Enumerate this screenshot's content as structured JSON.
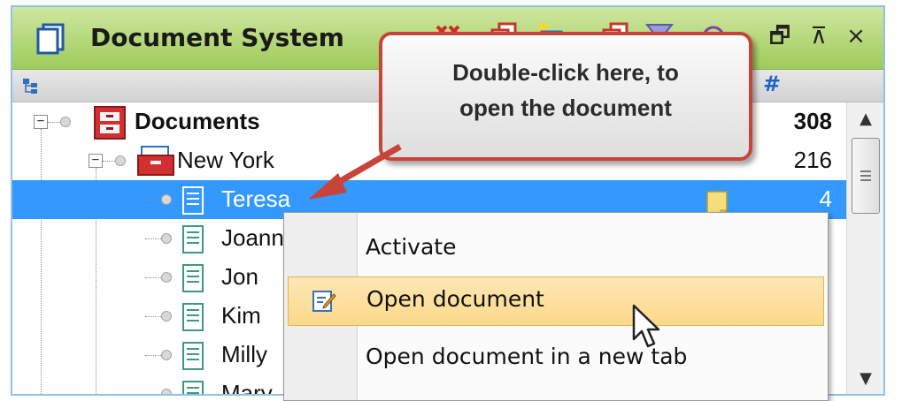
{
  "window": {
    "title": "Document System",
    "toolbar_icons": [
      "delete-icon",
      "copy-icon",
      "new-document-icon",
      "export-icon",
      "filter-icon",
      "search-icon"
    ],
    "window_buttons": {
      "restore": "🗗",
      "pin": "⊼",
      "close": "×"
    }
  },
  "column_header": {
    "tree_icon": "tree-structure-icon",
    "count_symbol": "#"
  },
  "tree": {
    "root": {
      "label": "Documents",
      "count": "308"
    },
    "group": {
      "label": "New York",
      "count": "216"
    },
    "items": [
      {
        "label": "Teresa",
        "count": "4",
        "selected": true
      },
      {
        "label": "Joann"
      },
      {
        "label": "Jon"
      },
      {
        "label": "Kim"
      },
      {
        "label": "Milly"
      },
      {
        "label": "Mary"
      }
    ]
  },
  "context_menu": {
    "items": [
      {
        "label": "Activate"
      },
      {
        "label": "Open document",
        "highlighted": true,
        "icon": "edit-document-icon"
      },
      {
        "label": "Open document in a new tab"
      }
    ]
  },
  "callout": {
    "line1": "Double-click here, to",
    "line2": "open the document"
  },
  "colors": {
    "selection": "#3399ff",
    "title_green": "#9fcb5a",
    "callout_border": "#c8443a",
    "menu_highlight": "#fbd98a"
  }
}
